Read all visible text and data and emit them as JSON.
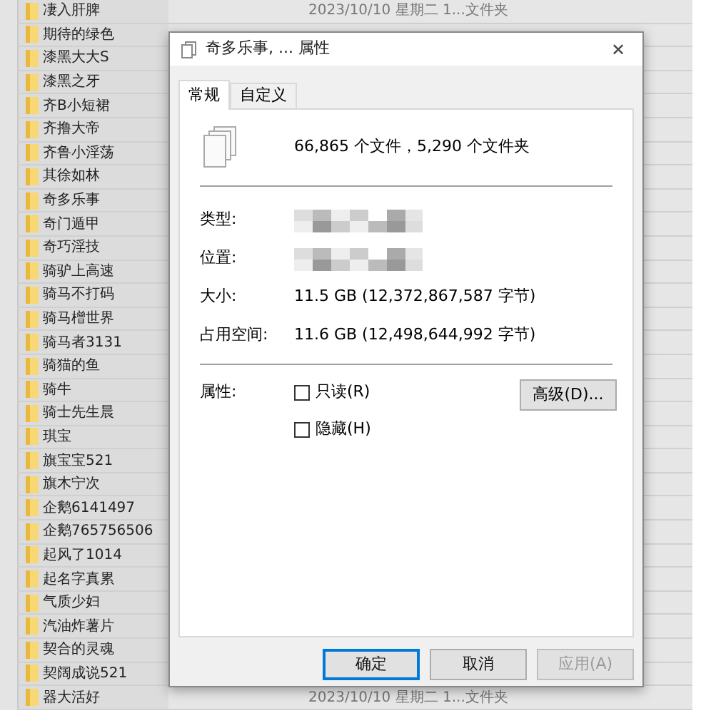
{
  "files": [
    {
      "name": "凄入肝脾",
      "date": "2023/10/10 星期二 1...",
      "type": "文件夹"
    },
    {
      "name": "期待的绿色"
    },
    {
      "name": "漆黑大大S"
    },
    {
      "name": "漆黑之牙"
    },
    {
      "name": "齐B小短裙"
    },
    {
      "name": "齐撸大帝"
    },
    {
      "name": "齐鲁小淫荡"
    },
    {
      "name": "其徐如林"
    },
    {
      "name": "奇多乐事"
    },
    {
      "name": "奇门遁甲"
    },
    {
      "name": "奇巧淫技"
    },
    {
      "name": "骑驴上高速"
    },
    {
      "name": "骑马不打码"
    },
    {
      "name": "骑马橧世界"
    },
    {
      "name": "骑马者3131"
    },
    {
      "name": "骑猫的鱼"
    },
    {
      "name": "骑牛"
    },
    {
      "name": "骑士先生晨"
    },
    {
      "name": "琪宝"
    },
    {
      "name": "旗宝宝521"
    },
    {
      "name": "旗木宁次"
    },
    {
      "name": "企鹅6141497"
    },
    {
      "name": "企鹅765756506"
    },
    {
      "name": "起风了1014"
    },
    {
      "name": "起名字真累"
    },
    {
      "name": "气质少妇"
    },
    {
      "name": "汽油炸薯片"
    },
    {
      "name": "契合的灵魂"
    },
    {
      "name": "契阔成说521"
    },
    {
      "name": "器大活好",
      "date": "2023/10/10 星期二 1...",
      "type": "文件夹"
    }
  ],
  "dialog": {
    "title": "奇多乐事, ... 属性",
    "close": "✕",
    "tabs": [
      {
        "label": "常规",
        "selected": true
      },
      {
        "label": "自定义",
        "selected": false
      }
    ],
    "summary": "66,865 个文件，5,290 个文件夹",
    "fields": [
      {
        "label": "类型:",
        "kind": "redacted"
      },
      {
        "label": "位置:",
        "kind": "redacted"
      },
      {
        "label": "大小:",
        "kind": "text",
        "value": "11.5 GB (12,372,867,587 字节)"
      },
      {
        "label": "占用空间:",
        "kind": "text",
        "value": "11.6 GB (12,498,644,992 字节)"
      }
    ],
    "attributes_label": "属性:",
    "attributes": [
      {
        "label": "只读(R)",
        "checked": false
      },
      {
        "label": "隐藏(H)",
        "checked": false
      }
    ],
    "advanced_button": "高级(D)...",
    "buttons": [
      {
        "label": "确定",
        "kind": "default",
        "disabled": false
      },
      {
        "label": "取消",
        "kind": "normal",
        "disabled": false
      },
      {
        "label": "应用(A)",
        "kind": "normal",
        "disabled": true
      }
    ]
  }
}
